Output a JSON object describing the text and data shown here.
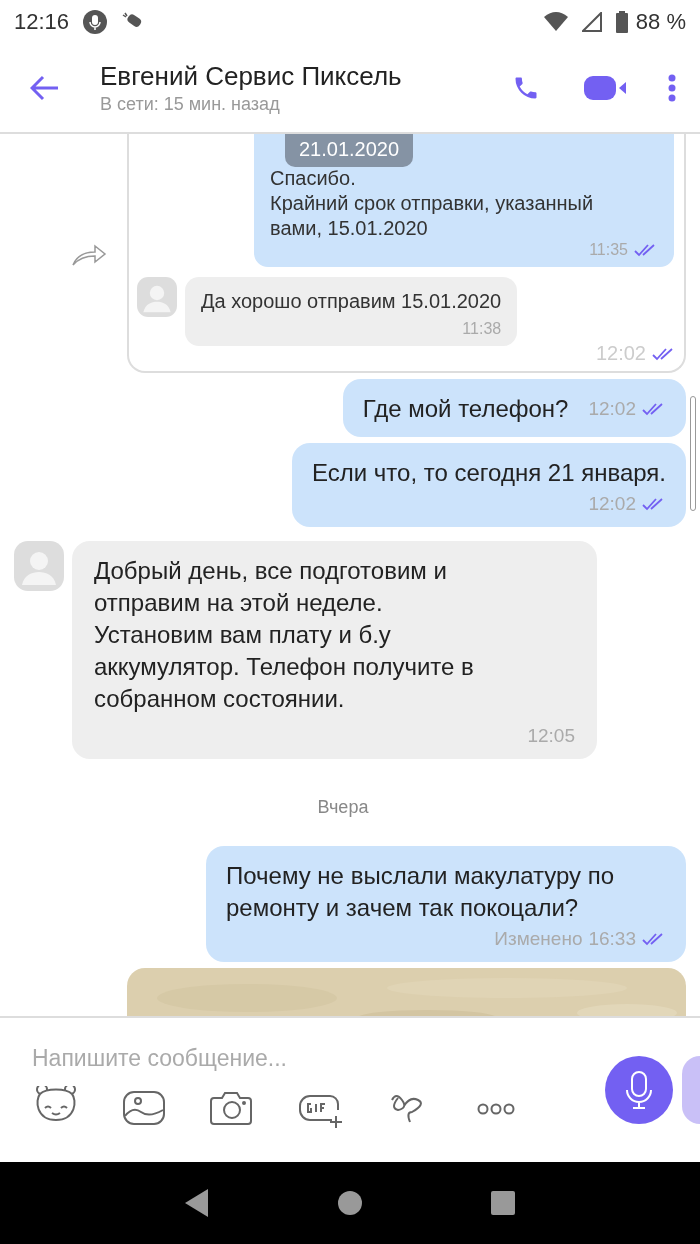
{
  "status_bar": {
    "time": "12:16",
    "battery": "88 %"
  },
  "header": {
    "title": "Евгений Сервис Пиксель",
    "subtitle": "В сети: 15 мин. назад"
  },
  "date_badge": "21.01.2020",
  "messages": [
    {
      "kind": "forwarded",
      "quote_lines": [
        "Спасибо.",
        "Крайний срок отправки, указанный вами, 15.01.2020"
      ],
      "quote_time": "11:35",
      "quote_read": true,
      "reply_text": "Да хорошо отправим 15.01.2020",
      "reply_time": "11:38",
      "time": "12:02",
      "read": true
    },
    {
      "kind": "outgoing",
      "text": "Где мой телефон?",
      "time": "12:02",
      "read": true,
      "inline": true
    },
    {
      "kind": "outgoing",
      "text": "Если что, то сегодня 21 января.",
      "time": "12:02",
      "read": true,
      "inline": false
    },
    {
      "kind": "incoming",
      "text": "Добрый день, все подготовим и отправим на этой неделе. Установим вам плату и б.у аккумулятор. Телефон получите в собранном состоянии.",
      "time": "12:05"
    },
    {
      "kind": "date",
      "text": "Вчера"
    },
    {
      "kind": "outgoing",
      "text": "Почему не выслали макулатуру по ремонту и зачем так покоцали?",
      "edited": "Изменено",
      "time": "16:33",
      "read": true,
      "inline": false
    },
    {
      "kind": "picture"
    }
  ],
  "composer": {
    "placeholder": "Напишите сообщение..."
  }
}
